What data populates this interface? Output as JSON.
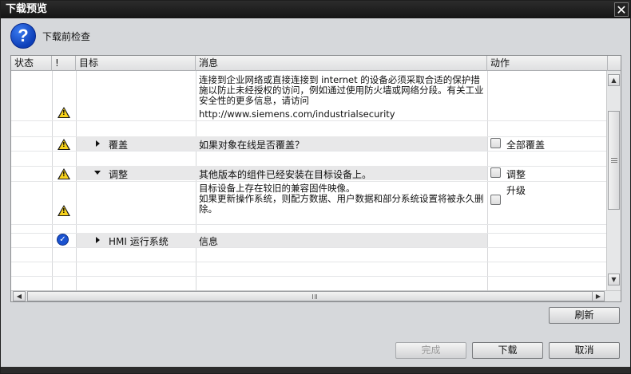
{
  "dialog": {
    "title": "下载预览",
    "close_glyph": "✕",
    "header_title": "下载前检查",
    "header_icon": "question-icon"
  },
  "columns": {
    "status": "状态",
    "bang": "!",
    "target": "目标",
    "message": "消息",
    "action": "动作"
  },
  "rows": {
    "security_msg": "连接到企业网络或直接连接到 internet 的设备必须采取合适的保护措施以防止未经授权的访问，例如通过使用防火墙或网络分段。有关工业安全性的更多信息，请访问",
    "security_url": "http://www.siemens.com/industrialsecurity",
    "overwrite_target": "覆盖",
    "overwrite_msg": "如果对象在线是否覆盖？",
    "overwrite_action": "全部覆盖",
    "adjust_target": "调整",
    "adjust_msg": "其他版本的组件已经安装在目标设备上。",
    "adjust_action": "调整",
    "firmware_msg": "目标设备上存在较旧的兼容固件映像。\n如果更新操作系统，则配方数据、用户数据和部分系统设置将被永久删除。",
    "firmware_action": "升级",
    "hmi_target": "HMI 运行系统",
    "hmi_msg": "信息"
  },
  "buttons": {
    "refresh": "刷新",
    "finish": "完成",
    "download": "下载",
    "cancel": "取消"
  },
  "colors": {
    "warning": "#f7d21c",
    "ok": "#1a52d0",
    "titlebar": "#141414",
    "dialog_bg": "#d6d8db"
  }
}
